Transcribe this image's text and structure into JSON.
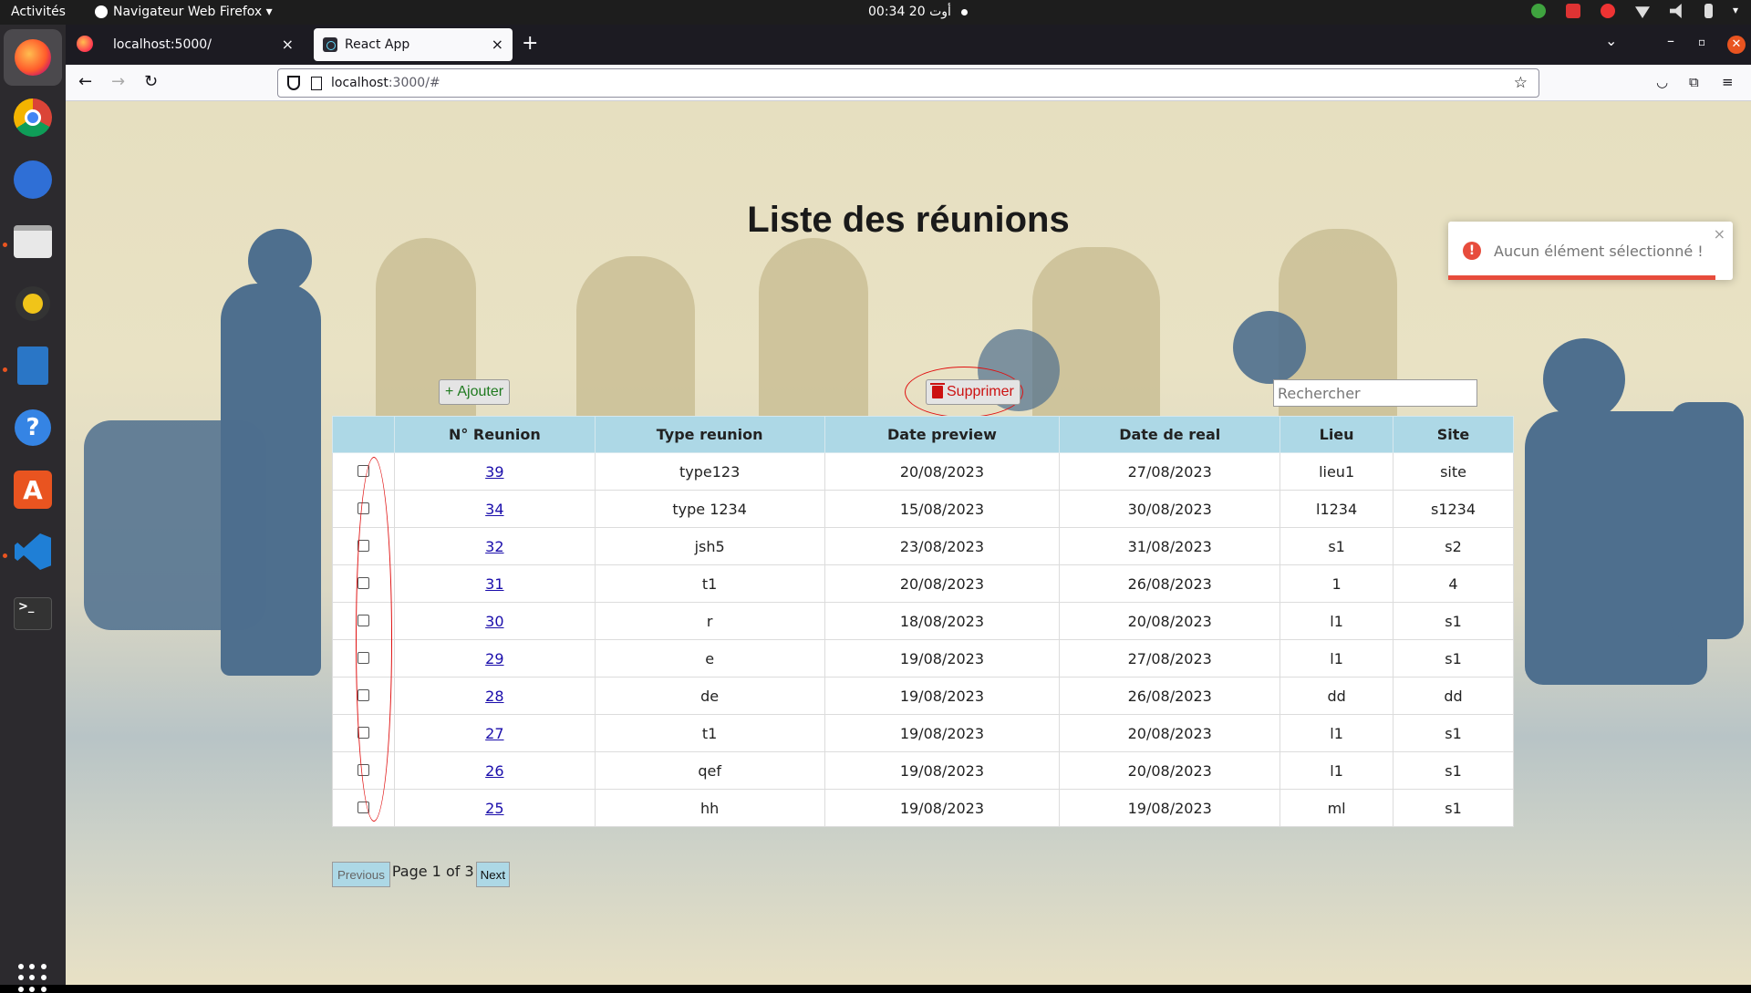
{
  "topbar": {
    "activities": "Activités",
    "app_menu": "Navigateur Web Firefox ▾",
    "clock": "00:34  أوت 20"
  },
  "browser": {
    "tabs": [
      {
        "label": "localhost:5000/"
      },
      {
        "label": "React App"
      }
    ],
    "url_host": "localhost",
    "url_rest": ":3000/#"
  },
  "page": {
    "title": "Liste des réunions",
    "add_label": "Ajouter",
    "delete_label": "Supprimer",
    "search_placeholder": "Rechercher",
    "columns": [
      "",
      "N° Reunion",
      "Type reunion",
      "Date preview",
      "Date de real",
      "Lieu",
      "Site"
    ],
    "rows": [
      {
        "num": "39",
        "type": "type123",
        "preview": "20/08/2023",
        "real": "27/08/2023",
        "lieu": "lieu1",
        "site": "site"
      },
      {
        "num": "34",
        "type": "type 1234",
        "preview": "15/08/2023",
        "real": "30/08/2023",
        "lieu": "l1234",
        "site": "s1234"
      },
      {
        "num": "32",
        "type": "jsh5",
        "preview": "23/08/2023",
        "real": "31/08/2023",
        "lieu": "s1",
        "site": "s2"
      },
      {
        "num": "31",
        "type": "t1",
        "preview": "20/08/2023",
        "real": "26/08/2023",
        "lieu": "1",
        "site": "4"
      },
      {
        "num": "30",
        "type": "r",
        "preview": "18/08/2023",
        "real": "20/08/2023",
        "lieu": "l1",
        "site": "s1"
      },
      {
        "num": "29",
        "type": "e",
        "preview": "19/08/2023",
        "real": "27/08/2023",
        "lieu": "l1",
        "site": "s1"
      },
      {
        "num": "28",
        "type": "de",
        "preview": "19/08/2023",
        "real": "26/08/2023",
        "lieu": "dd",
        "site": "dd"
      },
      {
        "num": "27",
        "type": "t1",
        "preview": "19/08/2023",
        "real": "20/08/2023",
        "lieu": "l1",
        "site": "s1"
      },
      {
        "num": "26",
        "type": "qef",
        "preview": "19/08/2023",
        "real": "20/08/2023",
        "lieu": "l1",
        "site": "s1"
      },
      {
        "num": "25",
        "type": "hh",
        "preview": "19/08/2023",
        "real": "19/08/2023",
        "lieu": "ml",
        "site": "s1"
      }
    ],
    "pager": {
      "previous": "Previous",
      "info": "Page 1 of 3",
      "next": "Next"
    },
    "toast": {
      "message": "Aucun élément sélectionné !"
    }
  },
  "colors": {
    "header_bg": "#add8e6",
    "delete_red": "#cc1111",
    "add_green": "#1f7a1f",
    "toast_error": "#e74c3c",
    "annotation_red": "#e01010"
  }
}
